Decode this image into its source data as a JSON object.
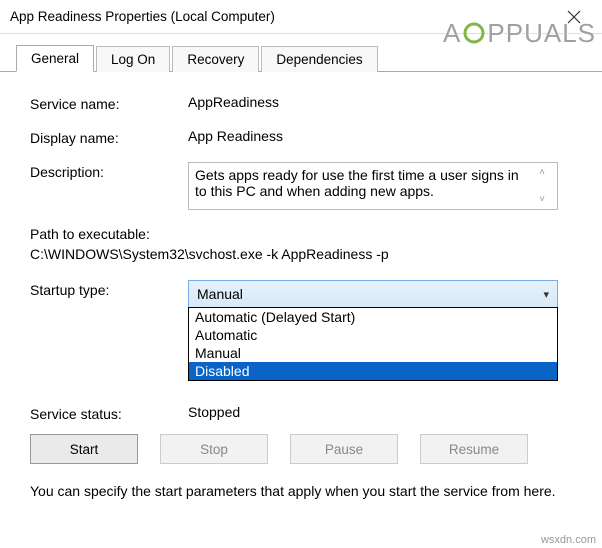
{
  "window": {
    "title": "App Readiness Properties (Local Computer)"
  },
  "watermark": {
    "pre": "A",
    "post": "PPUALS"
  },
  "tabs": [
    {
      "label": "General",
      "active": true
    },
    {
      "label": "Log On",
      "active": false
    },
    {
      "label": "Recovery",
      "active": false
    },
    {
      "label": "Dependencies",
      "active": false
    }
  ],
  "fields": {
    "service_name_label": "Service name:",
    "service_name_value": "AppReadiness",
    "display_name_label": "Display name:",
    "display_name_value": "App Readiness",
    "description_label": "Description:",
    "description_value": "Gets apps ready for use the first time a user signs in to this PC and when adding new apps.",
    "path_label": "Path to executable:",
    "path_value": "C:\\WINDOWS\\System32\\svchost.exe -k AppReadiness -p",
    "startup_type_label": "Startup type:",
    "startup_type_selected": "Manual",
    "startup_options": [
      "Automatic (Delayed Start)",
      "Automatic",
      "Manual",
      "Disabled"
    ],
    "startup_highlighted": "Disabled",
    "service_status_label": "Service status:",
    "service_status_value": "Stopped"
  },
  "buttons": {
    "start": "Start",
    "stop": "Stop",
    "pause": "Pause",
    "resume": "Resume"
  },
  "footer": "You can specify the start parameters that apply when you start the service from here.",
  "source": "wsxdn.com"
}
